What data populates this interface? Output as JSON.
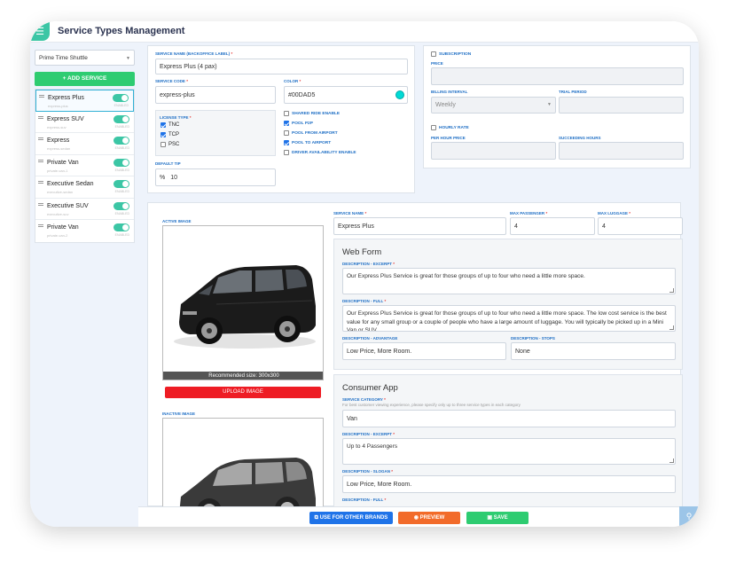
{
  "header": {
    "title": "Service Types Management"
  },
  "sidebar": {
    "brand": "Prime Time Shuttle",
    "add_label": "+ ADD SERVICE",
    "items": [
      {
        "name": "Express Plus",
        "sub": "express-plus",
        "status": "ENABLED"
      },
      {
        "name": "Express SUV",
        "sub": "express-suv",
        "status": "ENABLED"
      },
      {
        "name": "Express",
        "sub": "express-sedan",
        "status": "ENABLED"
      },
      {
        "name": "Private Van",
        "sub": "private-van-1",
        "status": "ENABLED"
      },
      {
        "name": "Executive Sedan",
        "sub": "executive-sedan",
        "status": "ENABLED"
      },
      {
        "name": "Executive SUV",
        "sub": "executive-suv",
        "status": "ENABLED"
      },
      {
        "name": "Private Van",
        "sub": "private-van-2",
        "status": "ENABLED"
      }
    ]
  },
  "service": {
    "name_label": "SERVICE NAME (BACKOFFICE LABEL)",
    "name_value": "Express Plus (4 pax)",
    "code_label": "SERVICE CODE",
    "code_value": "express-plus",
    "color_label": "COLOR",
    "color_value": "#00DAD5",
    "license_label": "LICENSE TYPE",
    "licenses": [
      {
        "label": "TNC",
        "checked": true
      },
      {
        "label": "TCP",
        "checked": true
      },
      {
        "label": "PSC",
        "checked": false
      }
    ],
    "options": [
      {
        "label": "SHARED RIDE ENABLE",
        "checked": false
      },
      {
        "label": "POOL P2P",
        "checked": true
      },
      {
        "label": "POOL FROM AIRPORT",
        "checked": false
      },
      {
        "label": "POOL TO AIRPORT",
        "checked": true
      },
      {
        "label": "DRIVER AVAILABILITY ENABLE",
        "checked": false
      }
    ],
    "tip_label": "DEFAULT TIP",
    "tip_prefix": "%",
    "tip_value": "10"
  },
  "subscription": {
    "subscription_label": "SUBSCRIPTION",
    "price_label": "PRICE",
    "billing_label": "BILLING INTERVAL",
    "billing_value": "Weekly",
    "trial_label": "TRIAL PERIOD",
    "hourly_label": "HOURLY RATE",
    "per_hour_label": "PER HOUR PRICE",
    "succeeding_label": "SUCCEEDING HOURS"
  },
  "images": {
    "active_label": "ACTIVE IMAGE",
    "recommended": "Recommended size: 300x300",
    "upload_label": "UPLOAD IMAGE",
    "inactive_label": "INACTIVE IMAGE"
  },
  "details": {
    "service_name_label": "SERVICE NAME",
    "service_name_value": "Express Plus",
    "max_pass_label": "MAX PASSENGER",
    "max_pass_value": "4",
    "max_lug_label": "MAX LUGGAGE",
    "max_lug_value": "4"
  },
  "web_form": {
    "title": "Web Form",
    "excerpt_label": "DESCRIPTION - EXCERPT",
    "excerpt_value": "Our Express Plus Service is great for those groups of up to four who need a little more space.",
    "full_label": "DESCRIPTION - FULL",
    "full_value": "Our Express Plus Service is great for those groups of up to four who need a little more space. The low cost service is the best value for any small group or a couple of people who have a large amount of luggage.  You will typically be picked up in a Mini Van or SUV.",
    "advantage_label": "DESCRIPTION - ADVANTAGE",
    "advantage_value": "Low Price, More Room.",
    "stops_label": "DESCRIPTION - STOPS",
    "stops_value": "None"
  },
  "consumer_app": {
    "title": "Consumer App",
    "category_label": "SERVICE CATEGORY",
    "category_hint": "For best customer viewing experience, please specify only up to three service types in each category",
    "category_value": "Van",
    "excerpt_label": "DESCRIPTION - EXCERPT",
    "excerpt_value": "Up to 4 Passengers",
    "slogan_label": "DESCRIPTION - SLOGAN",
    "slogan_value": "Low Price, More Room.",
    "full_label": "DESCRIPTION - FULL"
  },
  "footer": {
    "brands_label": "USE FOR OTHER BRANDS",
    "preview_label": "PREVIEW",
    "save_label": "SAVE"
  },
  "colors": {
    "accent": "#3cc6a5",
    "swatch": "#00DAD5",
    "primary": "#1f73e8",
    "preview": "#f26b2a",
    "save": "#2ecc71",
    "upload": "#ee1c24"
  }
}
